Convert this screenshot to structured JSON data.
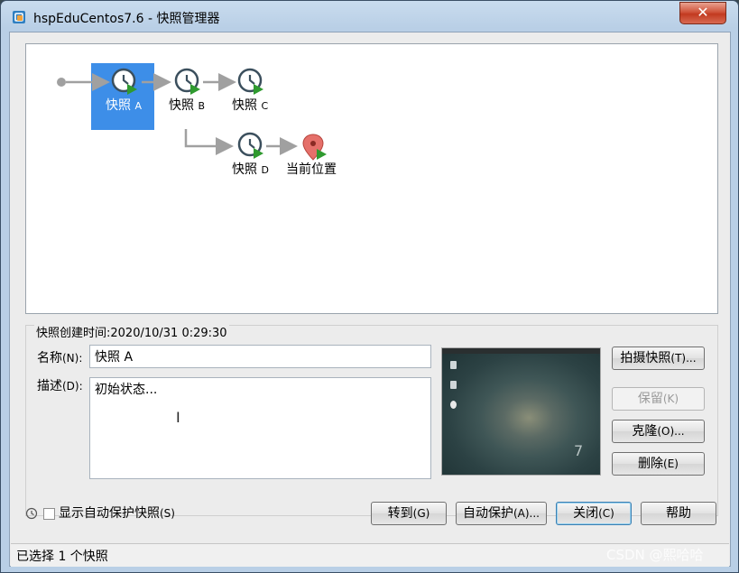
{
  "window": {
    "title": "hspEduCentos7.6 - 快照管理器",
    "close_glyph": "✕"
  },
  "tree": {
    "nodes": [
      {
        "name": "快照",
        "suffix": "A",
        "selected": true,
        "icon": "snapshot-clock-icon"
      },
      {
        "name": "快照",
        "suffix": "B",
        "selected": false,
        "icon": "snapshot-clock-icon"
      },
      {
        "name": "快照",
        "suffix": "C",
        "selected": false,
        "icon": "snapshot-clock-icon"
      },
      {
        "name": "快照",
        "suffix": "D",
        "selected": false,
        "icon": "snapshot-clock-icon"
      },
      {
        "name": "当前位置",
        "suffix": "",
        "selected": false,
        "icon": "current-location-pin-icon"
      }
    ],
    "colors": {
      "selected": "#3d8ee8",
      "arrow": "#a0a0a0",
      "play": "#2f9a2f",
      "pin": "#e5706a"
    }
  },
  "details": {
    "created_label": "快照创建时间:",
    "created_value": "2020/10/31 0:29:30",
    "name_label": "名称",
    "name_key": "(N):",
    "name_value": "快照 A",
    "desc_label": "描述",
    "desc_key": "(D):",
    "desc_value": "初始状态..."
  },
  "buttons": {
    "take_snapshot": "拍摄快照",
    "take_snapshot_key": "(T)...",
    "keep": "保留",
    "keep_key": "(K)",
    "clone": "克隆",
    "clone_key": "(O)...",
    "delete": "删除",
    "delete_key": "(E)",
    "goto": "转到",
    "goto_key": "(G)",
    "autoprotect": "自动保护",
    "autoprotect_key": "(A)...",
    "close": "关闭",
    "close_key": "(C)",
    "help": "帮助"
  },
  "options": {
    "show_autoprotect": "显示自动保护快照",
    "show_autoprotect_key": "(S)",
    "checked": false
  },
  "status": {
    "text": "已选择 1 个快照"
  },
  "watermark": "CSDN @熙哈哈"
}
